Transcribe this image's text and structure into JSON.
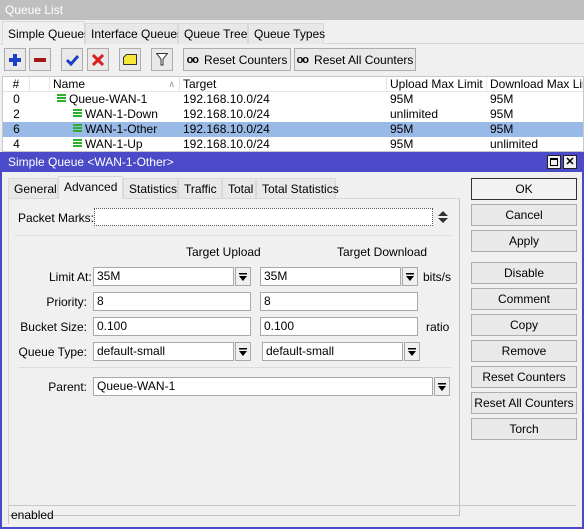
{
  "window": {
    "title": "Queue List"
  },
  "tabs": [
    {
      "label": "Simple Queues",
      "active": true
    },
    {
      "label": "Interface Queues",
      "active": false
    },
    {
      "label": "Queue Tree",
      "active": false
    },
    {
      "label": "Queue Types",
      "active": false
    }
  ],
  "toolbar": {
    "add_icon": "plus-icon",
    "remove_icon": "minus-icon",
    "enable_icon": "check-icon",
    "disable_icon": "x-icon",
    "comment_icon": "note-icon",
    "filter_icon": "filter-icon",
    "reset_counters_label": "Reset Counters",
    "reset_all_counters_label": "Reset All Counters",
    "counter_glyph": "oo",
    "colors": {
      "add": "#1a3fc8",
      "remove": "#a01818",
      "enable": "#1a3fc8",
      "disable": "#d81e1e",
      "comment": "#f5e83a"
    }
  },
  "table": {
    "columns": [
      "#",
      "",
      "Name",
      "Target",
      "Upload Max Limit",
      "Download Max Limit"
    ],
    "sort_indicator": "∧",
    "rows": [
      {
        "num": "0",
        "name": "Queue-WAN-1",
        "level": 0,
        "target": "192.168.10.0/24",
        "upload": "95M",
        "download": "95M",
        "selected": false
      },
      {
        "num": "2",
        "name": "WAN-1-Down",
        "level": 1,
        "target": "192.168.10.0/24",
        "upload": "unlimited",
        "download": "95M",
        "selected": false
      },
      {
        "num": "6",
        "name": "WAN-1-Other",
        "level": 1,
        "target": "192.168.10.0/24",
        "upload": "95M",
        "download": "95M",
        "selected": true
      },
      {
        "num": "4",
        "name": "WAN-1-Up",
        "level": 1,
        "target": "192.168.10.0/24",
        "upload": "95M",
        "download": "unlimited",
        "selected": false
      }
    ],
    "selected_color": "#99b9e6",
    "queue_icon_color": "#2db02d"
  },
  "dialog": {
    "title": "Simple Queue <WAN-1-Other>",
    "title_bg": "#4b4bc9",
    "tabs": [
      {
        "label": "General",
        "active": false
      },
      {
        "label": "Advanced",
        "active": true
      },
      {
        "label": "Statistics",
        "active": false
      },
      {
        "label": "Traffic",
        "active": false
      },
      {
        "label": "Total",
        "active": false
      },
      {
        "label": "Total Statistics",
        "active": false
      }
    ],
    "packet_marks": {
      "label": "Packet Marks:",
      "value": ""
    },
    "col_headers": {
      "upload": "Target Upload",
      "download": "Target Download"
    },
    "limit_at": {
      "label": "Limit At:",
      "upload": "35M",
      "download": "35M",
      "unit": "bits/s"
    },
    "priority": {
      "label": "Priority:",
      "upload": "8",
      "download": "8"
    },
    "bucket_size": {
      "label": "Bucket Size:",
      "upload": "0.100",
      "download": "0.100",
      "unit": "ratio"
    },
    "queue_type": {
      "label": "Queue Type:",
      "upload": "default-small",
      "download": "default-small"
    },
    "parent": {
      "label": "Parent:",
      "value": "Queue-WAN-1"
    },
    "buttons": [
      "OK",
      "Cancel",
      "Apply",
      "Disable",
      "Comment",
      "Copy",
      "Remove",
      "Reset Counters",
      "Reset All Counters",
      "Torch"
    ],
    "status": "enabled"
  }
}
